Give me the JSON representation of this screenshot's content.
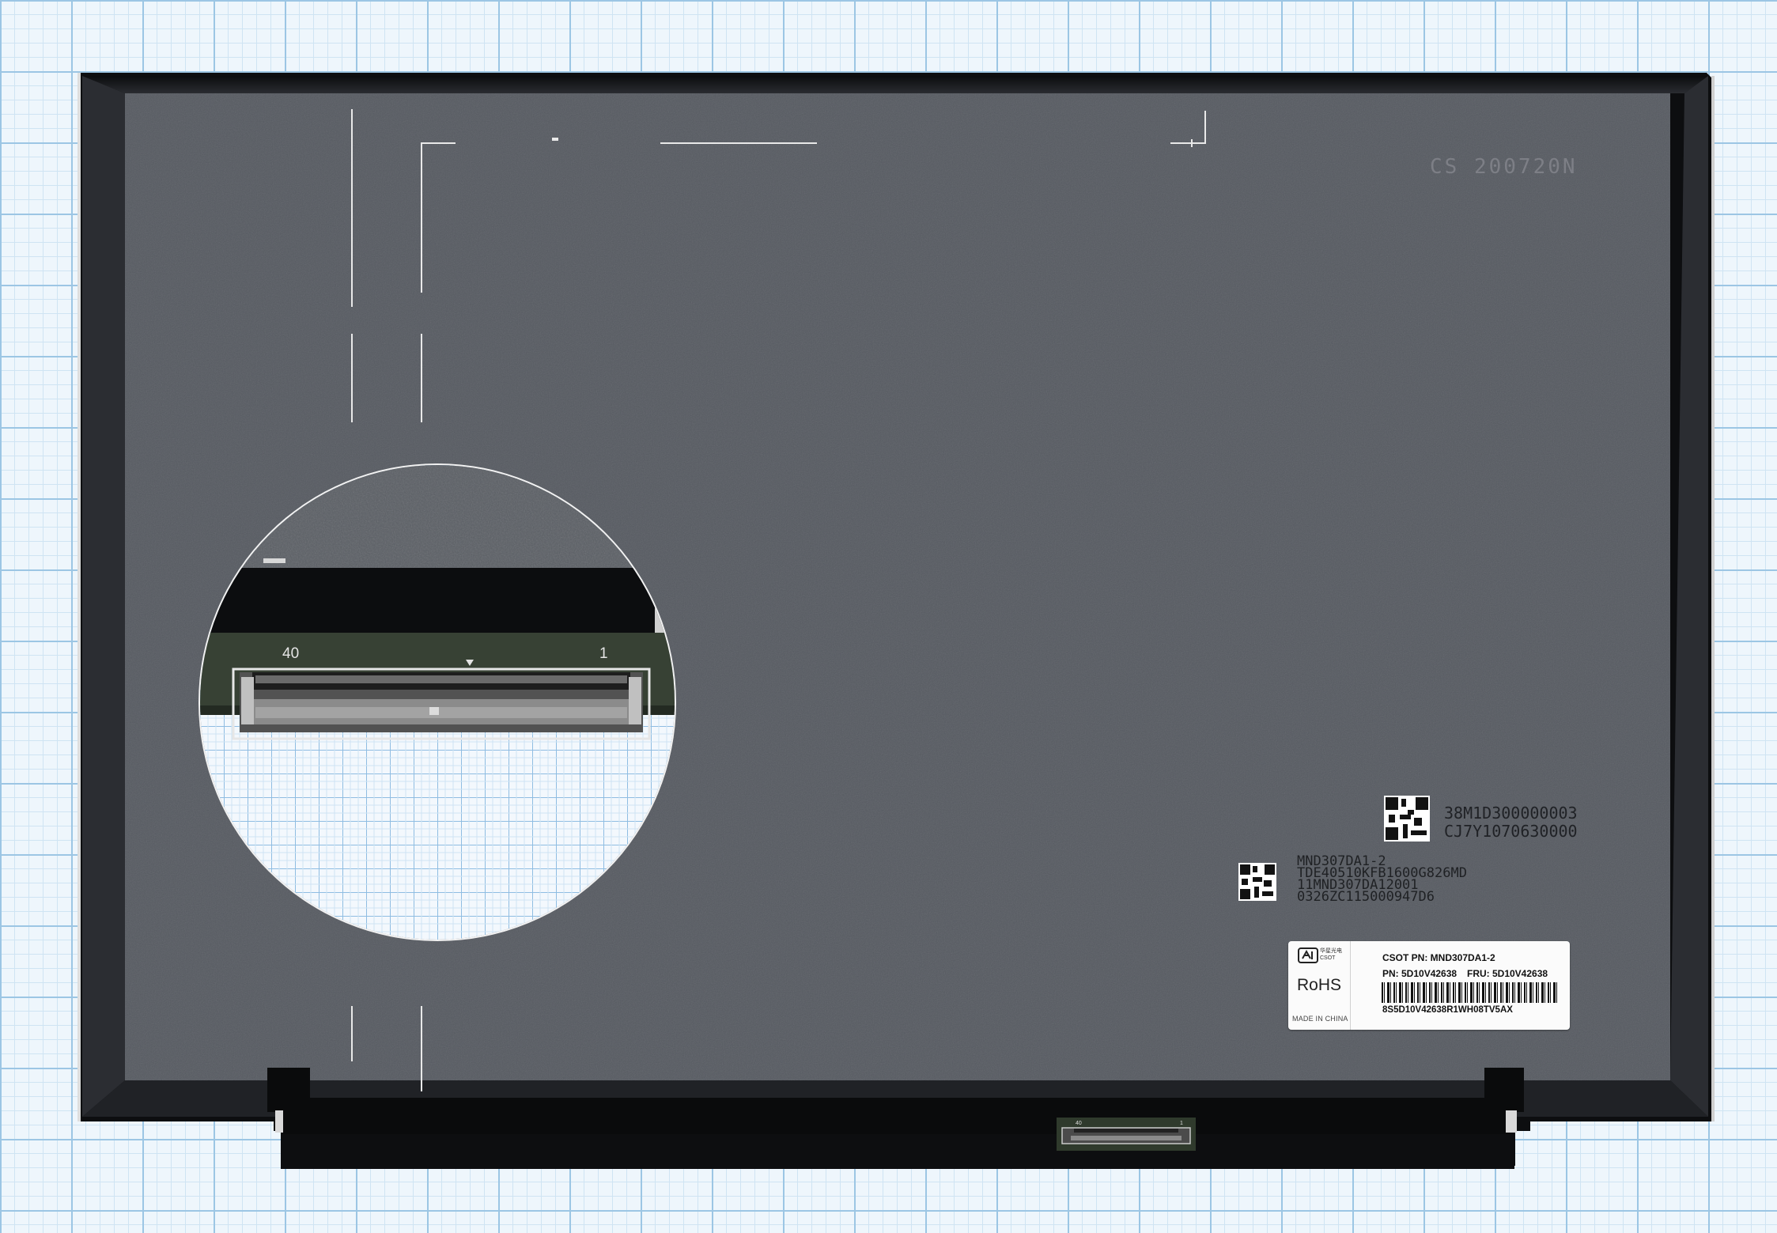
{
  "panel": {
    "cs_code": "CS 200720N",
    "serials_top": [
      "38M1D300000003",
      "CJ7Y1070630000"
    ],
    "lot_codes": [
      "MND307DA1-2",
      "TDE40510KFB1600G826MD",
      "11MND307DA12001",
      "0326ZC115000947D6"
    ]
  },
  "label": {
    "logo_text": "华星光电 CSOT",
    "rohs": "RoHS",
    "made_in": "MADE IN CHINA",
    "csot_pn": "CSOT PN: MND307DA1-2",
    "pn": "PN: 5D10V42638",
    "fru": "FRU: 5D10V42638",
    "serial": "8S5D10V42638R1WH08TV5AX"
  },
  "zoom_inset": {
    "pin_left": "40",
    "pin_right": "1"
  },
  "connector": {
    "pin_left": "40",
    "pin_right": "1"
  },
  "colors": {
    "panel_face": "#565a61",
    "frame": "#0d0e10",
    "grid_line": "#9cc6e4",
    "pcb": "#374134"
  }
}
